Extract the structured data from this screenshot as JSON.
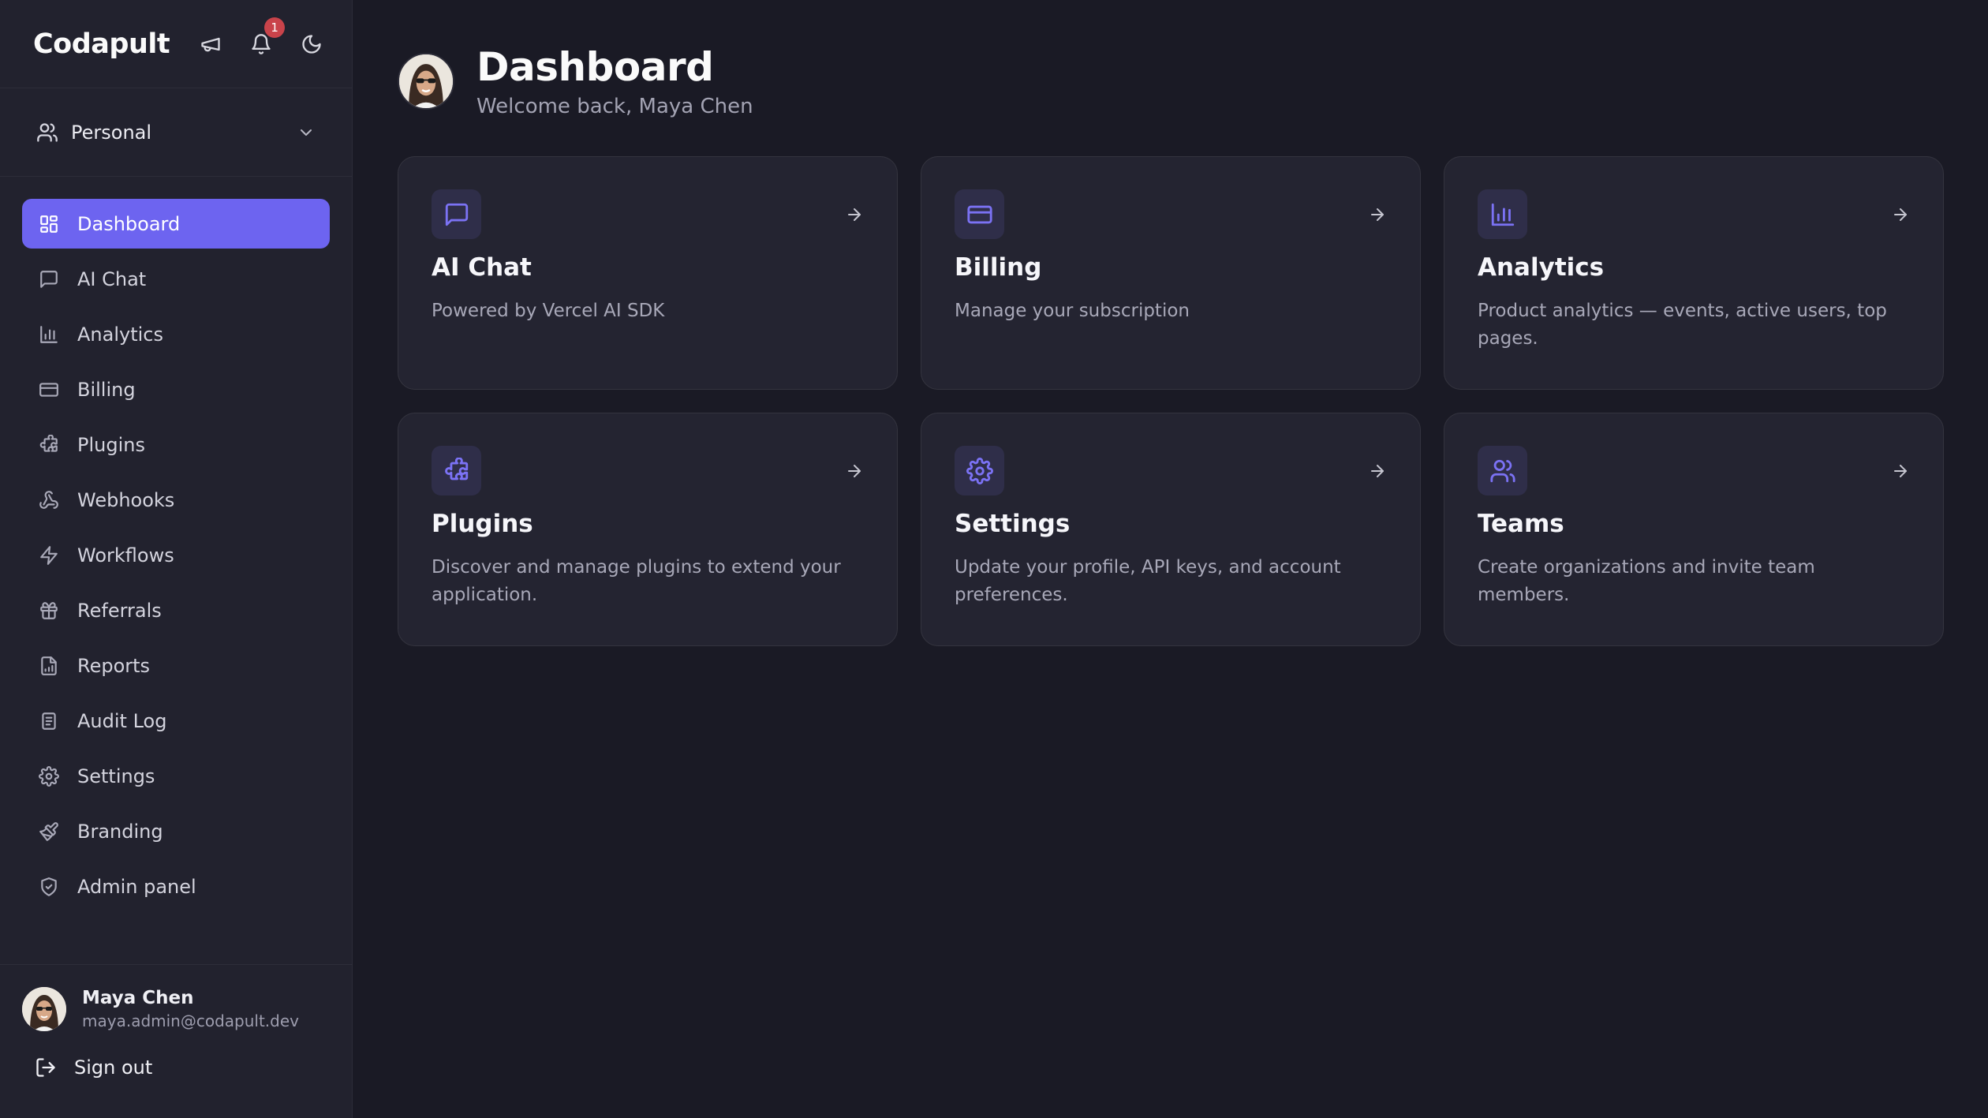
{
  "brand": "Codapult",
  "topbar": {
    "notifications_count": "1",
    "icons": [
      "megaphone-icon",
      "bell-icon",
      "moon-icon"
    ]
  },
  "workspace": {
    "label": "Personal"
  },
  "nav": [
    {
      "label": "Dashboard",
      "icon": "dashboard-icon",
      "active": true
    },
    {
      "label": "AI Chat",
      "icon": "chat-icon"
    },
    {
      "label": "Analytics",
      "icon": "bar-chart-icon"
    },
    {
      "label": "Billing",
      "icon": "credit-card-icon"
    },
    {
      "label": "Plugins",
      "icon": "puzzle-icon"
    },
    {
      "label": "Webhooks",
      "icon": "webhook-icon"
    },
    {
      "label": "Workflows",
      "icon": "zap-icon"
    },
    {
      "label": "Referrals",
      "icon": "gift-icon"
    },
    {
      "label": "Reports",
      "icon": "file-chart-icon"
    },
    {
      "label": "Audit Log",
      "icon": "clipboard-list-icon"
    },
    {
      "label": "Settings",
      "icon": "gear-icon"
    },
    {
      "label": "Branding",
      "icon": "paintbrush-icon"
    },
    {
      "label": "Admin panel",
      "icon": "shield-check-icon"
    }
  ],
  "user": {
    "name": "Maya Chen",
    "email": "maya.admin@codapult.dev"
  },
  "signout_label": "Sign out",
  "page": {
    "title": "Dashboard",
    "subtitle": "Welcome back, Maya Chen"
  },
  "cards": [
    {
      "title": "AI Chat",
      "description": "Powered by Vercel AI SDK",
      "icon": "chat-icon"
    },
    {
      "title": "Billing",
      "description": "Manage your subscription",
      "icon": "credit-card-icon"
    },
    {
      "title": "Analytics",
      "description": "Product analytics — events, active users, top pages.",
      "icon": "bar-chart-icon"
    },
    {
      "title": "Plugins",
      "description": "Discover and manage plugins to extend your application.",
      "icon": "puzzle-icon"
    },
    {
      "title": "Settings",
      "description": "Update your profile, API keys, and account preferences.",
      "icon": "gear-icon"
    },
    {
      "title": "Teams",
      "description": "Create organizations and invite team members.",
      "icon": "users-icon"
    }
  ],
  "colors": {
    "accent": "#6d64f0",
    "background": "#1a1a25",
    "sidebar": "#22222e",
    "card": "#242431",
    "badge": "#c9434a"
  }
}
